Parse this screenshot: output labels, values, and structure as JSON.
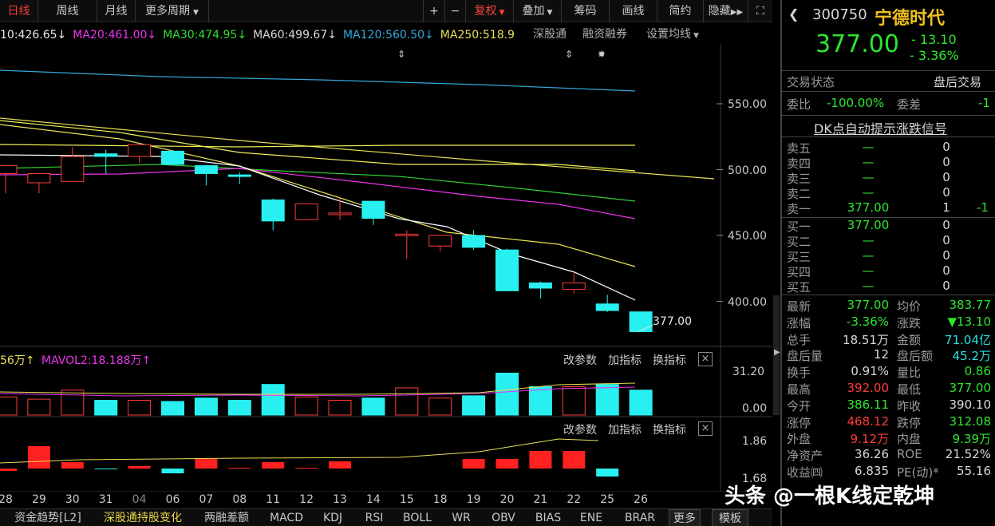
{
  "toolbar": {
    "day": "日线",
    "week": "周线",
    "month": "月线",
    "more_period": "更多周期",
    "plus": "+",
    "minus": "−",
    "fuquan": "复权",
    "diejia": "叠加",
    "chouma": "筹码",
    "huaxian": "画线",
    "jianyue": "简约",
    "yincang": "隐藏"
  },
  "ma": {
    "ma10": "10:426.65↓",
    "ma20": "MA20:461.00↓",
    "ma30": "MA30:474.95↓",
    "ma60": "MA60:499.67↓",
    "ma120": "MA120:560.50↓",
    "ma250": "MA250:518.9",
    "shengutong": "深股通",
    "rongzi": "融资融券",
    "set_ma": "设置均线"
  },
  "colors": {
    "up": "#ff3b3b",
    "down": "#28f0f0",
    "ma10": "#ffffff",
    "ma20": "#ee33ee",
    "ma30": "#33cc33",
    "ma60": "#eeee55",
    "ma120": "#33aadd",
    "ma250": "#e8e055"
  },
  "main_axis": [
    "550.00",
    "500.00",
    "450.00",
    "400.00"
  ],
  "last_price_label": "377.00",
  "vol": {
    "label1": "56万↑",
    "label2": "MAVOL2:18.188万↑",
    "gaicanshu": "改参数",
    "jiazhibiao": "加指标",
    "huanzhibiao": "换指标",
    "close": "×",
    "axis_top": "31.20",
    "axis_bottom": "0.00"
  },
  "ind": {
    "gaicanshu": "改参数",
    "jiazhibiao": "加指标",
    "huanzhibiao": "换指标",
    "close": "×",
    "axis_top": "1.86",
    "axis_bottom": "1.68"
  },
  "dates": [
    "28",
    "29",
    "30",
    "31",
    "04",
    "06",
    "07",
    "08",
    "11",
    "12",
    "13",
    "14",
    "15",
    "18",
    "19",
    "20",
    "21",
    "22",
    "25",
    "26"
  ],
  "chart_data": {
    "type": "candlestick",
    "categories": [
      "28",
      "29",
      "30",
      "31",
      "04",
      "06",
      "07",
      "08",
      "11",
      "12",
      "13",
      "14",
      "15",
      "18",
      "19",
      "20",
      "21",
      "22",
      "25",
      "26"
    ],
    "ohlc": [
      [
        497,
        503,
        482,
        489
      ],
      [
        490,
        497,
        482,
        489
      ],
      [
        491,
        510,
        491,
        517
      ],
      [
        512,
        510,
        497,
        515
      ],
      [
        510,
        519,
        505,
        514
      ],
      [
        514,
        504,
        503,
        512
      ],
      [
        503,
        497,
        488,
        503
      ],
      [
        496,
        495,
        489,
        498
      ],
      [
        477,
        461,
        454,
        478
      ],
      [
        462,
        474,
        462,
        474
      ],
      [
        467,
        467,
        462,
        478
      ],
      [
        476,
        463,
        458,
        476
      ],
      [
        451,
        451,
        432,
        454
      ],
      [
        442,
        450,
        438,
        450
      ],
      [
        450,
        441,
        439,
        454
      ],
      [
        439,
        408,
        408,
        440
      ],
      [
        414,
        410,
        402,
        415
      ],
      [
        409,
        414,
        406,
        422
      ],
      [
        398,
        393,
        392,
        405
      ],
      [
        392,
        377,
        377,
        391
      ]
    ],
    "volume": [
      16,
      14,
      22,
      13,
      13,
      12,
      15,
      13,
      27,
      16,
      13,
      15,
      24,
      15,
      17,
      37,
      25,
      25,
      27,
      22
    ]
  },
  "bottom_tabs": [
    "资金趋势[L2]",
    "深股通持股变化",
    "两融差额",
    "MACD",
    "KDJ",
    "RSI",
    "BOLL",
    "WR",
    "OBV",
    "BIAS",
    "ENE",
    "BRAR",
    "更多",
    "模板"
  ],
  "quote": {
    "code": "300750",
    "name": "宁德时代",
    "price": "377.00",
    "change": "- 13.10",
    "change_pct": "- 3.36%",
    "status_label": "交易状态",
    "status_value": "盘后交易",
    "weibi_label": "委比",
    "weibi_value": "-100.00%",
    "weicha_label": "委差",
    "weicha_value": "-1",
    "dk_signal": "DK点自动提示涨跌信号",
    "asks": [
      {
        "label": "卖五",
        "price": "—",
        "vol": "0",
        "chg": ""
      },
      {
        "label": "卖四",
        "price": "—",
        "vol": "0",
        "chg": ""
      },
      {
        "label": "卖三",
        "price": "—",
        "vol": "0",
        "chg": ""
      },
      {
        "label": "卖二",
        "price": "—",
        "vol": "0",
        "chg": ""
      },
      {
        "label": "卖一",
        "price": "377.00",
        "vol": "1",
        "chg": "-1"
      }
    ],
    "bids": [
      {
        "label": "买一",
        "price": "377.00",
        "vol": "0"
      },
      {
        "label": "买二",
        "price": "—",
        "vol": "0"
      },
      {
        "label": "买三",
        "price": "—",
        "vol": "0"
      },
      {
        "label": "买四",
        "price": "—",
        "vol": "0"
      },
      {
        "label": "买五",
        "price": "—",
        "vol": "0"
      }
    ],
    "stats": [
      {
        "l1": "最新",
        "v1": "377.00",
        "c1": "gr",
        "l2": "均价",
        "v2": "383.77",
        "c2": "gr"
      },
      {
        "l1": "涨幅",
        "v1": "-3.36%",
        "c1": "gr",
        "l2": "涨跌",
        "v2": "▼13.10",
        "c2": "gr"
      },
      {
        "l1": "总手",
        "v1": "18.51万",
        "c1": "wh",
        "l2": "金额",
        "v2": "71.04亿",
        "c2": "cy"
      },
      {
        "l1": "盘后量",
        "v1": "12",
        "c1": "wh",
        "l2": "盘后额",
        "v2": "45.2万",
        "c2": "cy"
      },
      {
        "l1": "换手",
        "v1": "0.91%",
        "c1": "wh",
        "l2": "量比",
        "v2": "0.86",
        "c2": "gr"
      },
      {
        "l1": "最高",
        "v1": "392.00",
        "c1": "rd",
        "l2": "最低",
        "v2": "377.00",
        "c2": "gr"
      },
      {
        "l1": "今开",
        "v1": "386.11",
        "c1": "gr",
        "l2": "昨收",
        "v2": "390.10",
        "c2": "wh"
      },
      {
        "l1": "涨停",
        "v1": "468.12",
        "c1": "rd",
        "l2": "跌停",
        "v2": "312.08",
        "c2": "gr"
      },
      {
        "l1": "外盘",
        "v1": "9.12万",
        "c1": "rd",
        "l2": "内盘",
        "v2": "9.39万",
        "c2": "gr"
      },
      {
        "l1": "净资产",
        "v1": "36.26",
        "c1": "wh",
        "l2": "ROE",
        "v2": "21.52%",
        "c2": "wh"
      },
      {
        "l1": "收益㈣",
        "v1": "6.835",
        "c1": "wh",
        "l2": "PE(动)*",
        "v2": "55.16",
        "c2": "wh"
      }
    ]
  },
  "watermark": "头条 @一根K线定乾坤"
}
